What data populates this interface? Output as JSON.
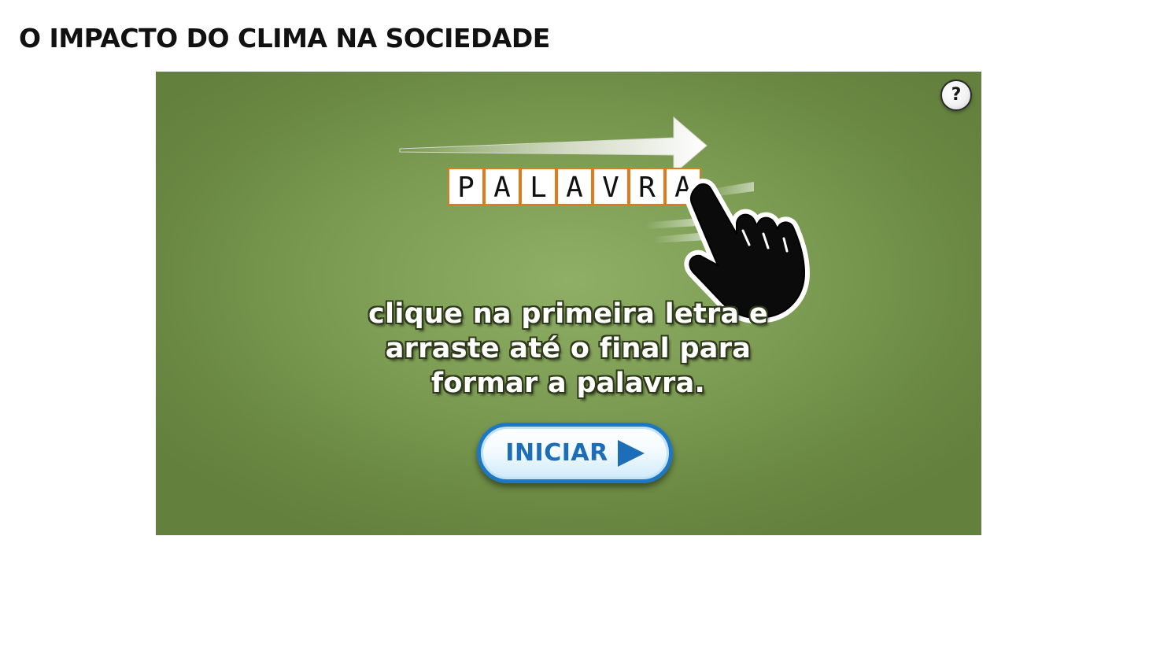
{
  "page": {
    "title": "O IMPACTO DO CLIMA NA SOCIEDADE"
  },
  "game": {
    "help_label": "?",
    "example_word_letters": [
      "P",
      "A",
      "L",
      "A",
      "V",
      "R",
      "A"
    ],
    "instruction_lines": [
      "clique na primeira letra e",
      "arraste até o final para",
      "formar a palavra."
    ],
    "start_label": "INICIAR",
    "icons": {
      "help": "question-mark-icon",
      "start": "play-arrow-icon",
      "drag_arrow": "arrow-right-icon",
      "hand": "pointing-hand-icon"
    },
    "colors": {
      "background": "#7c9c53",
      "tile_border": "#e07a1c",
      "button_border": "#1e77c4",
      "button_text": "#1d6db8"
    }
  }
}
